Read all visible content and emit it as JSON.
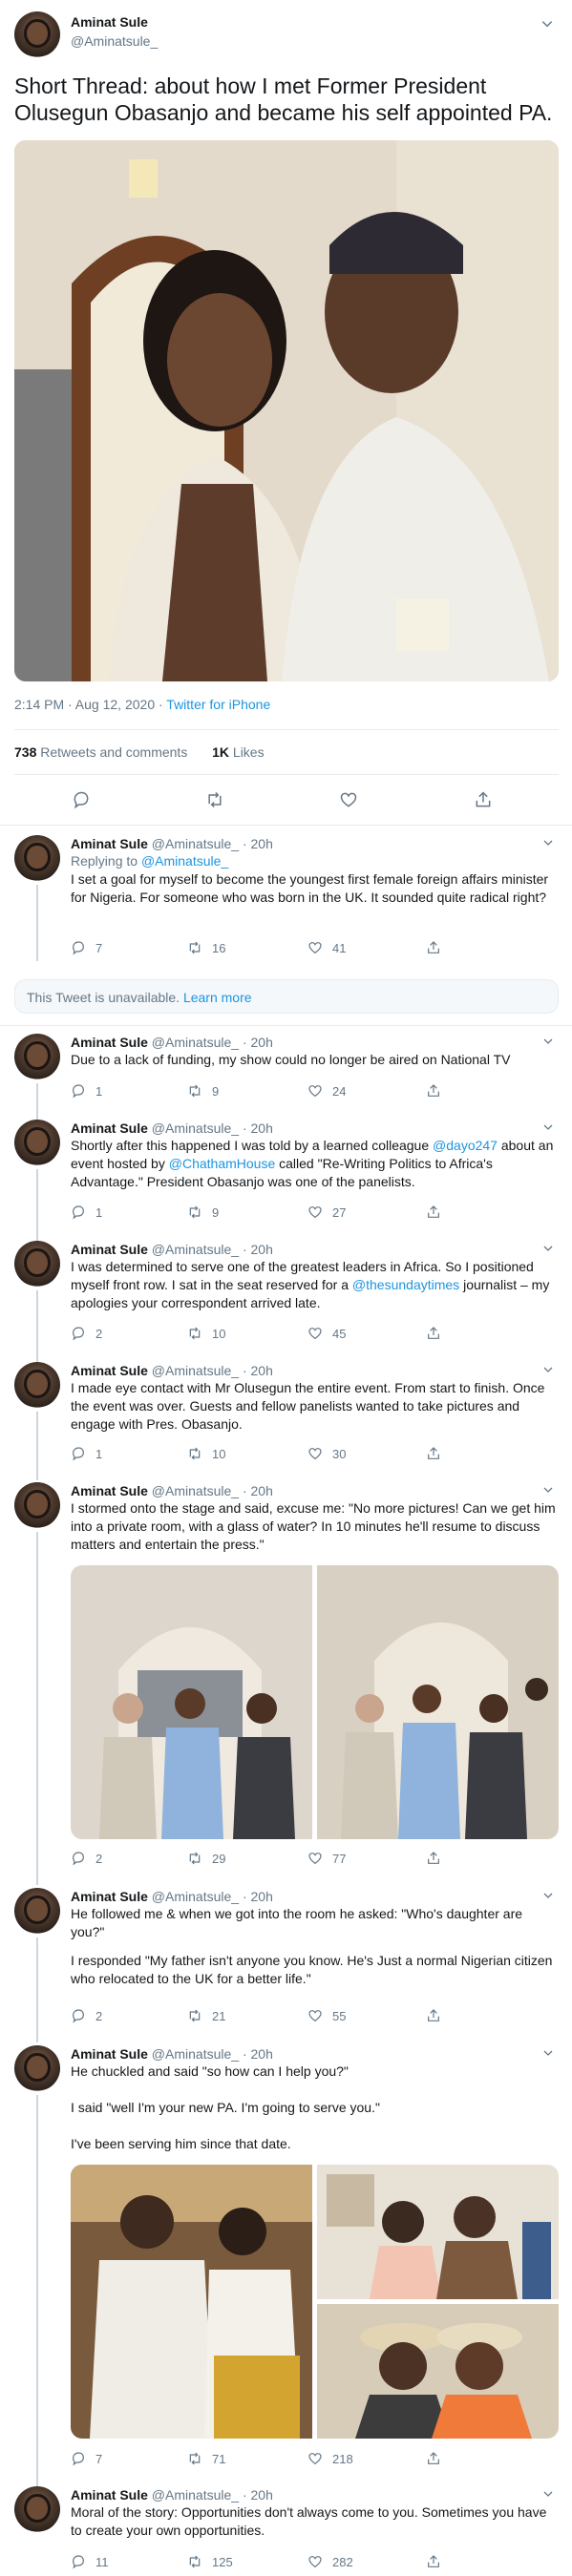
{
  "main": {
    "author_name": "Aminat Sule",
    "author_handle": "@Aminatsule_",
    "text": "Short Thread: about how I met Former President Olusegun Obasanjo and became his self appointed PA.",
    "time": "2:14 PM · Aug 12, 2020 · ",
    "source": "Twitter for iPhone",
    "retweets_count": "738",
    "retweets_label": " Retweets and comments",
    "likes_count": "1K",
    "likes_label": " Likes"
  },
  "unavailable": {
    "text": "This Tweet is unavailable. ",
    "link": "Learn more"
  },
  "replies": [
    {
      "name": "Aminat Sule",
      "meta": "@Aminatsule_ · 20h",
      "replying_prefix": "Replying to ",
      "replying_handle": "@Aminatsule_",
      "text": "I set a goal for myself to become the youngest first female foreign affairs minister for Nigeria. For someone who was born in the UK. It sounded quite radical right?",
      "reply_count": "7",
      "retweet_count": "16",
      "like_count": "41"
    },
    {
      "name": "Aminat Sule",
      "meta": "@Aminatsule_ · 20h",
      "text": "Due to a lack of funding, my show could no longer be aired on National TV",
      "reply_count": "1",
      "retweet_count": "9",
      "like_count": "24"
    },
    {
      "name": "Aminat Sule",
      "meta": "@Aminatsule_ · 20h",
      "text_a": "Shortly after this happened I was told by a learned colleague ",
      "mention_a": "@dayo247",
      "text_b": " about an event hosted by ",
      "mention_b": "@ChathamHouse",
      "text_c": " called \"Re-Writing Politics to Africa's Advantage.\" President Obasanjo was one of the panelists.",
      "reply_count": "1",
      "retweet_count": "9",
      "like_count": "27"
    },
    {
      "name": "Aminat Sule",
      "meta": "@Aminatsule_ · 20h",
      "text_a": "I was determined to serve one of the greatest leaders in Africa. So I positioned myself front row. I sat in the seat reserved for a ",
      "mention_a": "@thesundaytimes",
      "text_b": " journalist – my apologies your correspondent arrived late.",
      "reply_count": "2",
      "retweet_count": "10",
      "like_count": "45"
    },
    {
      "name": "Aminat Sule",
      "meta": "@Aminatsule_ · 20h",
      "text": "I made eye contact with Mr Olusegun the entire event. From start to finish. Once the event was over. Guests and fellow panelists wanted to take pictures and engage with Pres. Obasanjo.",
      "reply_count": "1",
      "retweet_count": "10",
      "like_count": "30"
    },
    {
      "name": "Aminat Sule",
      "meta": "@Aminatsule_ · 20h",
      "text": "I stormed onto the stage and said, excuse me: \"No more pictures! Can we get him into a private room, with a glass of water? In 10 minutes he'll resume to discuss matters and entertain the press.\"",
      "reply_count": "2",
      "retweet_count": "29",
      "like_count": "77"
    },
    {
      "name": "Aminat Sule",
      "meta": "@Aminatsule_ · 20h",
      "text_a": "He followed me & when we got into the room he asked: \"Who's daughter are you?\"",
      "text_b": "I responded \"My father isn't  anyone you know. He's Just a normal Nigerian citizen who relocated to the UK for a better life.\"",
      "reply_count": "2",
      "retweet_count": "21",
      "like_count": "55"
    },
    {
      "name": "Aminat Sule",
      "meta": "@Aminatsule_ · 20h",
      "text_a": "He chuckled and said \"so how can I help you?\"",
      "text_b": "I said \"well I'm your new PA. I'm going to serve you.\"",
      "text_c": "I've been serving him since that date.",
      "reply_count": "7",
      "retweet_count": "71",
      "like_count": "218"
    },
    {
      "name": "Aminat Sule",
      "meta": "@Aminatsule_ · 20h",
      "text": "Moral of the story: Opportunities don't always come to you. Sometimes you have to create your own opportunities.",
      "reply_count": "11",
      "retweet_count": "125",
      "like_count": "282"
    }
  ],
  "colors": {
    "link": "#1b95e0",
    "muted": "#657786",
    "text": "#14171a",
    "border": "#e6ecf0"
  }
}
